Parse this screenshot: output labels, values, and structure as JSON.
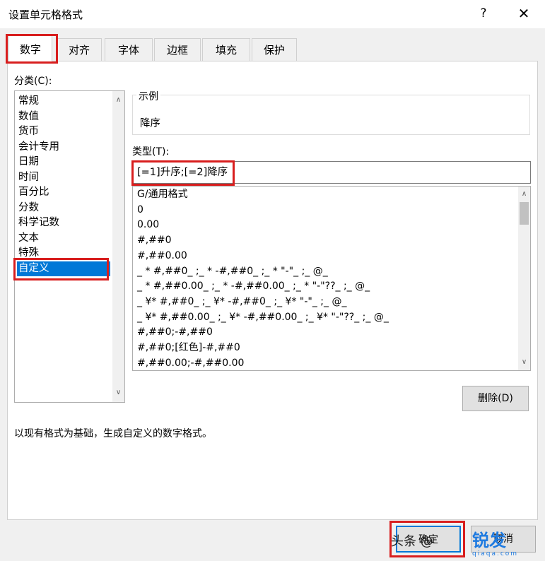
{
  "window": {
    "title": "设置单元格格式",
    "help": "?",
    "close": "✕"
  },
  "tabs": [
    {
      "label": "数字",
      "active": true
    },
    {
      "label": "对齐"
    },
    {
      "label": "字体"
    },
    {
      "label": "边框"
    },
    {
      "label": "填充"
    },
    {
      "label": "保护"
    }
  ],
  "category": {
    "label": "分类(C):",
    "items": [
      "常规",
      "数值",
      "货币",
      "会计专用",
      "日期",
      "时间",
      "百分比",
      "分数",
      "科学记数",
      "文本",
      "特殊",
      "自定义"
    ],
    "selected": "自定义"
  },
  "sample": {
    "label": "示例",
    "value": "降序"
  },
  "type": {
    "label": "类型(T):",
    "value": "[=1]升序;[=2]降序",
    "formats": [
      "G/通用格式",
      "0",
      "0.00",
      "#,##0",
      "#,##0.00",
      "_ * #,##0_ ;_ * -#,##0_ ;_ * \"-\"_ ;_ @_",
      "_ * #,##0.00_ ;_ * -#,##0.00_ ;_ * \"-\"??_ ;_ @_",
      "_ ¥* #,##0_ ;_ ¥* -#,##0_ ;_ ¥* \"-\"_ ;_ @_",
      "_ ¥* #,##0.00_ ;_ ¥* -#,##0.00_ ;_ ¥* \"-\"??_ ;_ @_",
      "#,##0;-#,##0",
      "#,##0;[红色]-#,##0",
      "#,##0.00;-#,##0.00"
    ]
  },
  "delete_button": "删除(D)",
  "description": "以现有格式为基础，生成自定义的数字格式。",
  "footer": {
    "ok": "确定",
    "cancel": "取消"
  },
  "watermark": {
    "text": "头条 @    ",
    "logo": "锐发",
    "logo_sub": "qiaqa.com"
  },
  "colors": {
    "accent": "#0078d7",
    "highlight": "#d81e1e"
  }
}
